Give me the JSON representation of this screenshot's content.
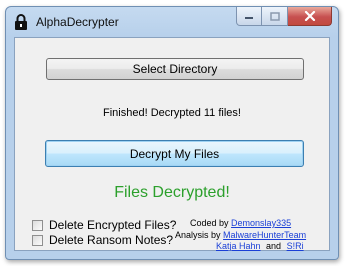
{
  "window": {
    "title": "AlphaDecrypter"
  },
  "buttons": {
    "select_directory": "Select Directory",
    "decrypt": "Decrypt My Files"
  },
  "status_text": "Finished! Decrypted 11 files!",
  "result_text": "Files Decrypted!",
  "options": {
    "delete_encrypted": {
      "label": "Delete Encrypted Files?",
      "checked": false
    },
    "delete_ransom_notes": {
      "label": "Delete Ransom Notes?",
      "checked": false
    }
  },
  "credits": {
    "coded_by_label": "Coded by",
    "coded_by_name": "Demonslay335",
    "analysis_by_label": "Analysis by",
    "analysis_team": "MalwareHunterTeam",
    "analyst_1": "Katja Hahn",
    "and_text": "and",
    "analyst_2": "S!Ri"
  },
  "colors": {
    "result_green": "#2ca02c",
    "link_blue": "#1a3fd6",
    "close_red": "#c75050"
  },
  "icons": {
    "title": "padlock-icon",
    "minimize": "minimize-icon",
    "maximize": "maximize-icon",
    "close": "close-icon"
  }
}
